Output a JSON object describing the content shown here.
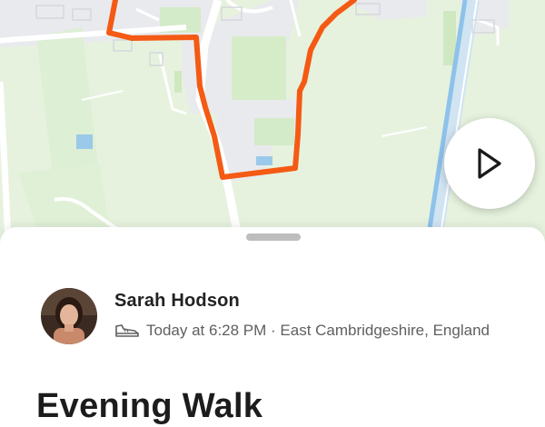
{
  "map": {
    "play_icon": "play-icon",
    "route_color": "#f45a14",
    "land_color": "#e4f2dc",
    "road_color": "#ffffff",
    "urban_color": "#e8e9ec",
    "water_color": "#94c3e8"
  },
  "activity": {
    "athlete_name": "Sarah Hodson",
    "activity_icon": "shoe-icon",
    "meta": "Today at 6:28 PM · East Cambridgeshire, England",
    "title": "Evening Walk"
  }
}
